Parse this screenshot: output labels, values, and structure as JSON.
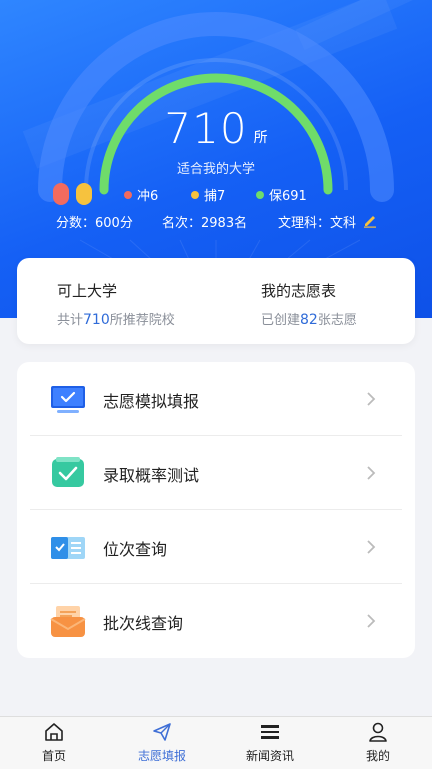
{
  "hero": {
    "score": "710",
    "score_unit": "所",
    "subtitle": "适合我的大学",
    "legend": [
      {
        "label": "冲6",
        "color": "#f26b5f"
      },
      {
        "label": "捕7",
        "color": "#f6c23e"
      },
      {
        "label": "保691",
        "color": "#6fdc6a"
      }
    ],
    "info": {
      "score_text": "分数：600分",
      "rank_text": "名次：2983名",
      "subject_text": "文理科：文科"
    },
    "colors": {
      "arc": "#6fdc6a",
      "bg": "#1560f5"
    }
  },
  "summary": {
    "left": {
      "title": "可上大学",
      "prefix": "共计",
      "count": "710",
      "suffix": "所推荐院校"
    },
    "right": {
      "title": "我的志愿表",
      "prefix": "已创建",
      "count": "82",
      "suffix": "张志愿"
    }
  },
  "menu": [
    {
      "label": "志愿模拟填报",
      "icon": "monitor-check-icon"
    },
    {
      "label": "录取概率测试",
      "icon": "checkbox-icon"
    },
    {
      "label": "位次查询",
      "icon": "list-card-icon"
    },
    {
      "label": "批次线查询",
      "icon": "envelope-icon"
    }
  ],
  "tabs": [
    {
      "label": "首页",
      "icon": "home-icon",
      "active": false
    },
    {
      "label": "志愿填报",
      "icon": "paper-plane-icon",
      "active": true
    },
    {
      "label": "新闻资讯",
      "icon": "news-icon",
      "active": false
    },
    {
      "label": "我的",
      "icon": "user-icon",
      "active": false
    }
  ]
}
